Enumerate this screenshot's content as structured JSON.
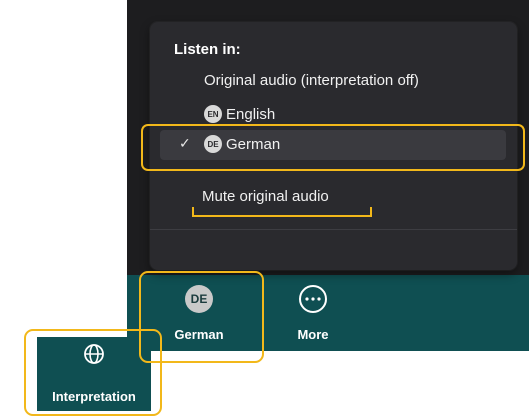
{
  "menu": {
    "header": "Listen in:",
    "options": [
      {
        "label": "Original audio (interpretation off)"
      },
      {
        "badge": "EN",
        "label": "English"
      },
      {
        "badge": "DE",
        "label": "German",
        "selected": true,
        "check": "✓"
      }
    ],
    "mute_label": "Mute original audio"
  },
  "toolbar": {
    "language_button": {
      "badge": "DE",
      "label": "German"
    },
    "more_button": {
      "label": "More",
      "icon": "ellipsis-circle-icon"
    },
    "interpretation_button": {
      "label": "Interpretation",
      "icon": "globe-icon"
    }
  },
  "colors": {
    "toolbar_bg": "#0f4f52",
    "menu_bg": "#2a2a2e",
    "selected_row_bg": "#3a3a3f",
    "highlight": "#f2b81a"
  }
}
